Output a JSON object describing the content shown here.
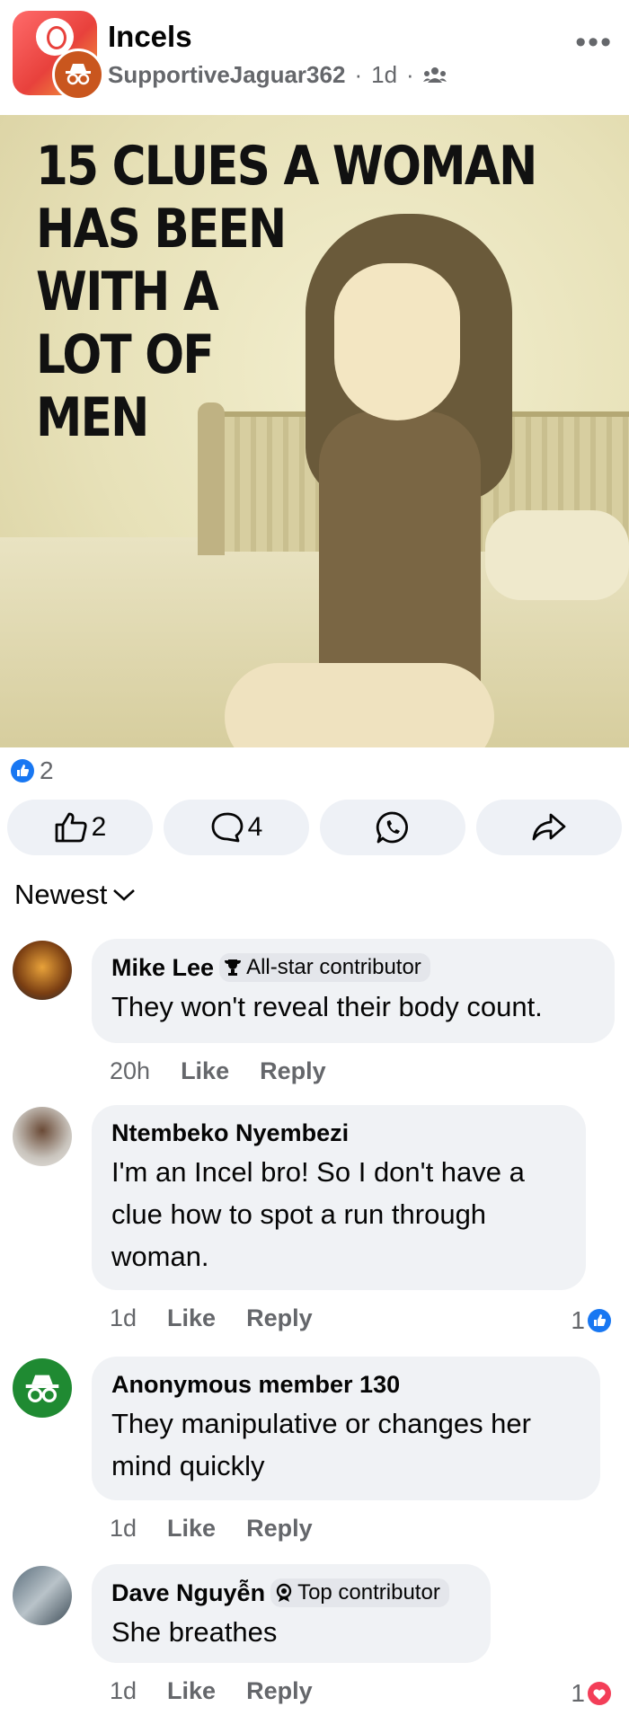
{
  "header": {
    "group_name": "Incels",
    "author": "SupportiveJaguar362",
    "time": "1d",
    "more_label": "•••"
  },
  "post": {
    "headline": [
      "15 CLUES A WOMAN",
      "HAS BEEN",
      "WITH A",
      "LOT OF",
      "MEN"
    ],
    "reaction_count": "2"
  },
  "actions": {
    "like_count": "2",
    "comment_count": "4"
  },
  "sort_label": "Newest",
  "comments": [
    {
      "name": "Mike Lee",
      "badge": "All-star contributor",
      "text": "They won't reveal their body count.",
      "time": "20h",
      "like": "Like",
      "reply": "Reply",
      "reactions": ""
    },
    {
      "name": "Ntembeko Nyembezi",
      "badge": "",
      "text": "I'm an Incel bro! So I don't have a clue how to spot a run through woman.",
      "time": "1d",
      "like": "Like",
      "reply": "Reply",
      "reactions": "1"
    },
    {
      "name": "Anonymous member 130",
      "badge": "",
      "text": "They manipulative or changes her mind quickly",
      "time": "1d",
      "like": "Like",
      "reply": "Reply",
      "reactions": ""
    },
    {
      "name": "Dave Nguyễn",
      "badge": "Top contributor",
      "text": "She breathes",
      "time": "1d",
      "like": "Like",
      "reply": "Reply",
      "reactions": "1"
    }
  ],
  "colors": {
    "like_blue": "#1877f2",
    "love_red": "#f33e58",
    "bubble": "#f0f2f5",
    "anon_green": "#1f8a32"
  }
}
